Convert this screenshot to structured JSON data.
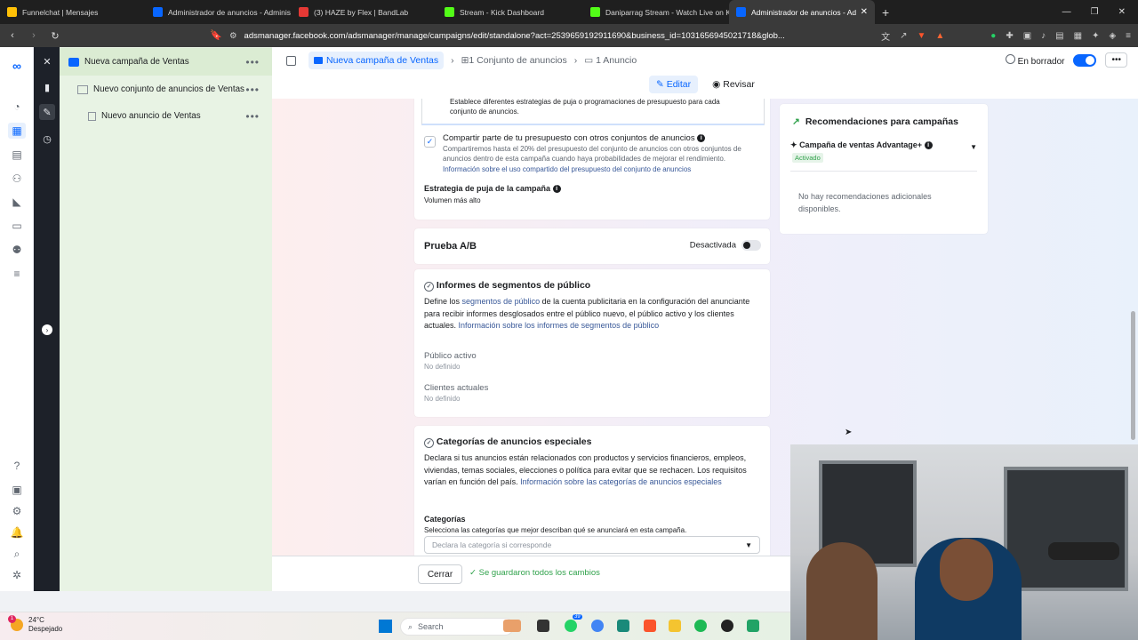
{
  "browser": {
    "tabs": [
      {
        "label": "Funnelchat | Mensajes",
        "color": "#ffc107"
      },
      {
        "label": "Administrador de anuncios - Adminis",
        "color": "#0866ff"
      },
      {
        "label": "(3) HAZE by Flex | BandLab",
        "color": "#e53935"
      },
      {
        "label": "Stream - Kick Dashboard",
        "color": "#53fc18"
      },
      {
        "label": "Daniparrag Stream - Watch Live on K",
        "color": "#53fc18"
      },
      {
        "label": "Administrador de anuncios - Ad",
        "color": "#0866ff"
      }
    ],
    "url": "adsmanager.facebook.com/adsmanager/manage/campaigns/edit/standalone?act=2539659192911690&business_id=1031656945021718&glob..."
  },
  "tree": {
    "campaign": "Nueva campaña de Ventas",
    "adset": "Nuevo conjunto de anuncios de Ventas",
    "ad": "Nuevo anuncio de Ventas"
  },
  "header": {
    "crumb_campaign": "Nueva campaña de Ventas",
    "crumb_adset": "1 Conjunto de anuncios",
    "crumb_ad": "1 Anuncio",
    "status": "En borrador",
    "edit": "Editar",
    "review": "Revisar"
  },
  "budget": {
    "top_text": "Establece diferentes estrategias de puja o programaciones de presupuesto para cada conjunto de anuncios.",
    "share_label": "Compartir parte de tu presupuesto con otros conjuntos de anuncios",
    "share_desc": "Compartiremos hasta el 20% del presupuesto del conjunto de anuncios con otros conjuntos de anuncios dentro de esta campaña cuando haya probabilidades de mejorar el rendimiento.",
    "share_link": "Información sobre el uso compartido del presupuesto del conjunto de anuncios",
    "bid_label": "Estrategia de puja de la campaña",
    "bid_value": "Volumen más alto"
  },
  "ab_test": {
    "title": "Prueba A/B",
    "state": "Desactivada"
  },
  "segments": {
    "title": "Informes de segmentos de público",
    "desc_prefix": "Define los",
    "desc_link": "segmentos de público",
    "desc_mid": "de la cuenta publicitaria en la configuración del anunciante para recibir informes desglosados entre el público nuevo, el público activo y los clientes actuales.",
    "desc_link2": "Información sobre los informes de segmentos de público",
    "active_label": "Público activo",
    "active_value": "No definido",
    "current_label": "Clientes actuales",
    "current_value": "No definido"
  },
  "special": {
    "title": "Categorías de anuncios especiales",
    "desc": "Declara si tus anuncios están relacionados con productos y servicios financieros, empleos, viviendas, temas sociales, elecciones o política para evitar que se rechacen. Los requisitos varían en función del país.",
    "desc_link": "Información sobre las categorías de anuncios especiales",
    "cat_label": "Categorías",
    "cat_desc": "Selecciona las categorías que mejor describan qué se anunciará en esta campaña.",
    "cat_placeholder": "Declara la categoría si corresponde"
  },
  "recommendations": {
    "title": "Recomendaciones para campañas",
    "item": "Campaña de ventas Advantage+",
    "item_status": "Activado",
    "empty": "No hay recomendaciones adicionales disponibles."
  },
  "footer": {
    "close": "Cerrar",
    "saved": "Se guardaron todos los cambios"
  },
  "taskbar": {
    "temp": "24°C",
    "weather": "Despejado",
    "badge": "1",
    "search": "Search",
    "whatsapp_badge": "39"
  }
}
